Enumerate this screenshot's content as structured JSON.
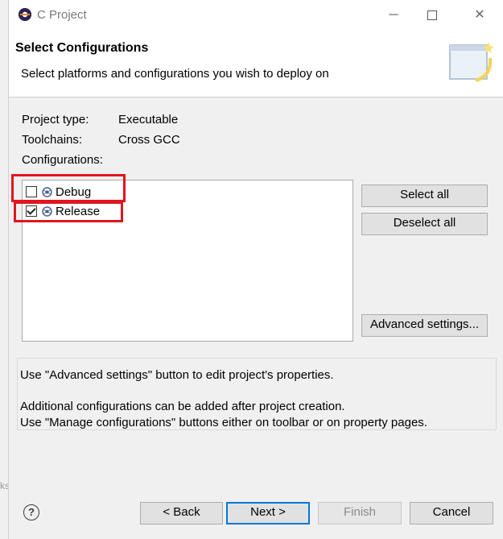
{
  "window": {
    "title": "C Project"
  },
  "header": {
    "title": "Select Configurations",
    "description": "Select platforms and configurations you wish to deploy on"
  },
  "fields": {
    "project_type_label": "Project type:",
    "project_type_value": "Executable",
    "toolchains_label": "Toolchains:",
    "toolchains_value": "Cross GCC",
    "configurations_label": "Configurations:"
  },
  "configurations": [
    {
      "label": "Debug",
      "checked": false
    },
    {
      "label": "Release",
      "checked": true
    }
  ],
  "side_buttons": {
    "select_all": "Select all",
    "deselect_all": "Deselect all",
    "advanced": "Advanced settings..."
  },
  "info": {
    "line1": "Use \"Advanced settings\" button to edit project's properties.",
    "line2": "Additional configurations can be added after project creation.",
    "line3": "Use \"Manage configurations\" buttons either on toolbar or on property pages."
  },
  "footer": {
    "back": "< Back",
    "next": "Next >",
    "finish": "Finish",
    "cancel": "Cancel"
  },
  "background_peek": "ks",
  "colors": {
    "highlight": "#e0161e",
    "default_button_border": "#0078d7"
  },
  "icons": [
    "eclipse-app-icon",
    "minimize-icon",
    "maximize-icon",
    "close-icon",
    "wizard-banner-icon",
    "configuration-icon",
    "help-icon"
  ]
}
